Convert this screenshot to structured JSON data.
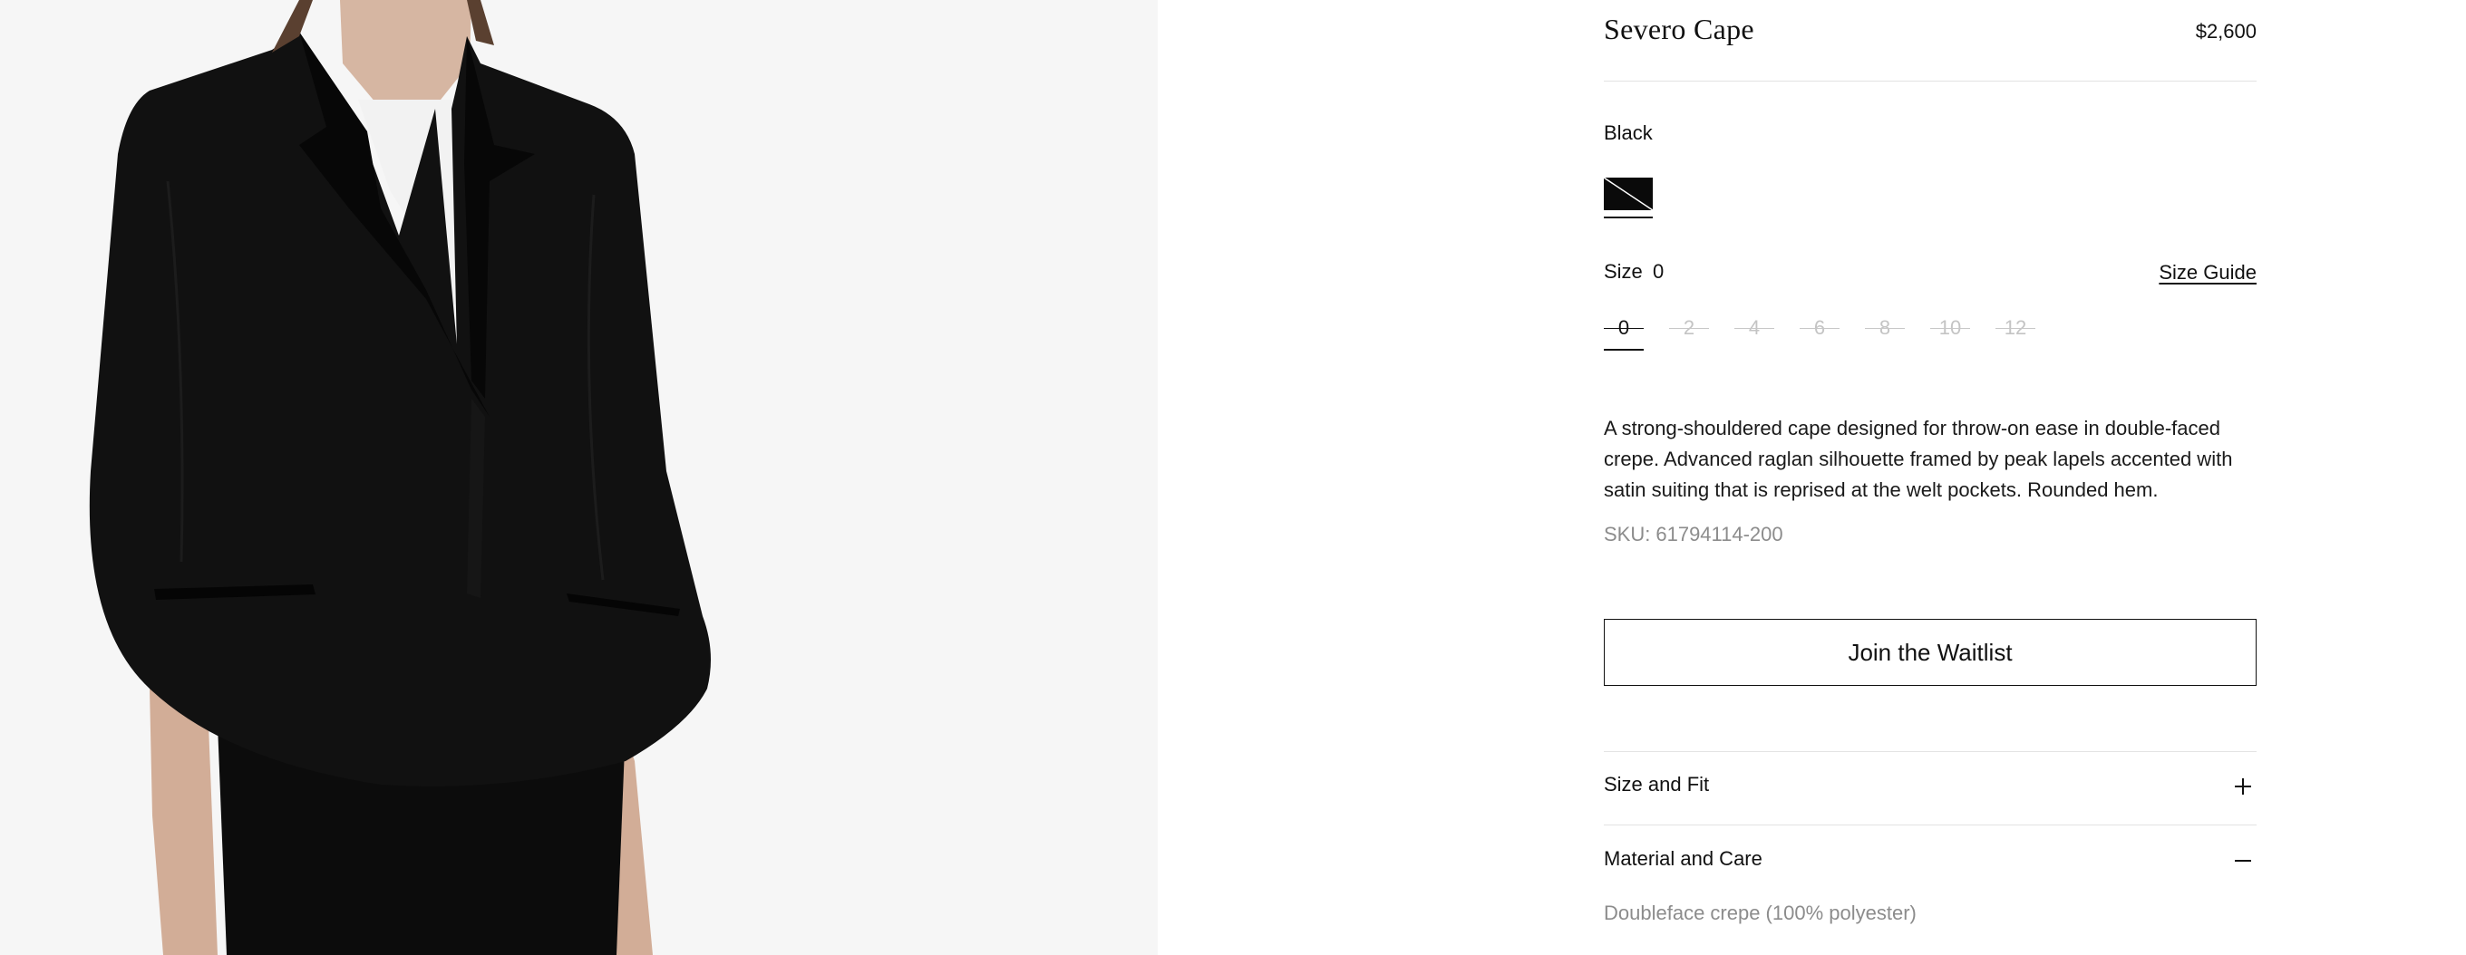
{
  "product": {
    "title": "Severo Cape",
    "price": "$2,600",
    "color": "Black",
    "swatch_color": "#0a0a0a",
    "size_label": "Size",
    "selected_size": "0",
    "size_guide": "Size Guide",
    "sizes": [
      {
        "label": "0",
        "selected": true,
        "available": false
      },
      {
        "label": "2",
        "selected": false,
        "available": false
      },
      {
        "label": "4",
        "selected": false,
        "available": false
      },
      {
        "label": "6",
        "selected": false,
        "available": false
      },
      {
        "label": "8",
        "selected": false,
        "available": false
      },
      {
        "label": "10",
        "selected": false,
        "available": false
      },
      {
        "label": "12",
        "selected": false,
        "available": false
      }
    ],
    "description": "A strong-shouldered cape designed for throw-on ease in double-faced crepe. Advanced raglan silhouette framed by peak lapels accented with satin suiting that is reprised at the welt pockets. Rounded hem.",
    "sku_label": "SKU:",
    "sku_value": "61794114-200",
    "cta": "Join the Waitlist"
  },
  "accordions": [
    {
      "label": "Size and Fit",
      "expanded": false,
      "icon": "plus-icon"
    },
    {
      "label": "Material and Care",
      "expanded": true,
      "icon": "minus-icon",
      "content": "Doubleface crepe (100% polyester)"
    }
  ],
  "colors": {
    "background_image": "#f6f6f6",
    "text": "#111111",
    "muted": "#8c8c8c",
    "divider": "#e3e3e3"
  }
}
